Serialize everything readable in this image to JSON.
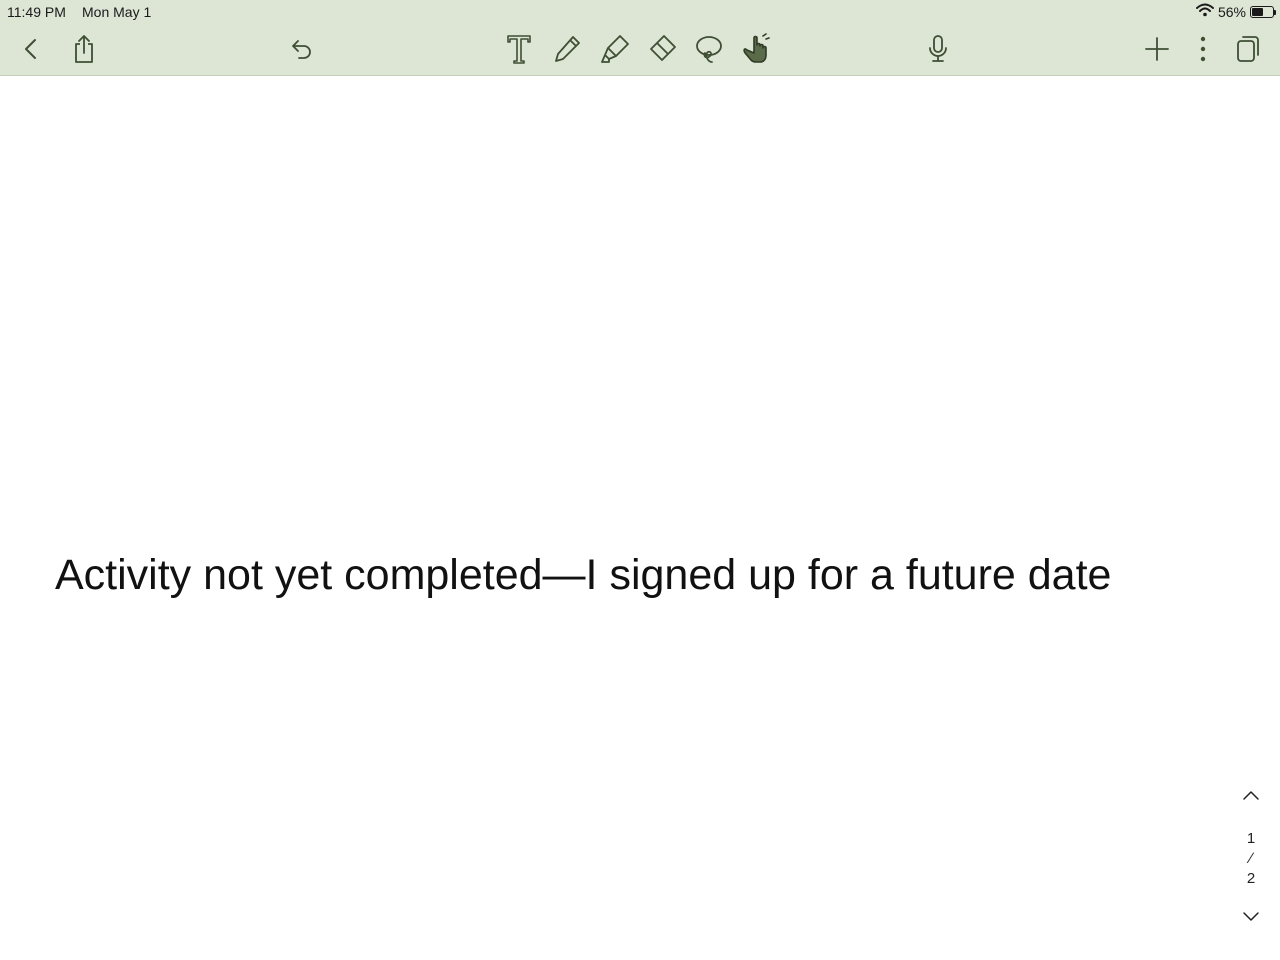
{
  "status_bar": {
    "time": "11:49 PM",
    "date": "Mon May 1",
    "battery_percent": "56%",
    "battery_level": 0.56,
    "icons": [
      "wifi-icon",
      "battery-icon"
    ]
  },
  "toolbar": {
    "left": [
      "back-icon",
      "share-icon",
      "undo-icon"
    ],
    "tools": [
      "text-tool-icon",
      "pen-tool-icon",
      "highlighter-tool-icon",
      "eraser-tool-icon",
      "lasso-tool-icon",
      "hand-tool-icon"
    ],
    "active_tool": "hand-tool-icon",
    "right": [
      "microphone-icon",
      "add-icon",
      "more-icon",
      "pages-icon"
    ],
    "colors": {
      "background": "#dde5d5",
      "icon": "#3f4f34",
      "active_fill": "#5a6b4a"
    }
  },
  "document": {
    "text": "Activity not yet completed—I signed up for a future date"
  },
  "pager": {
    "current": "1",
    "separator": "∕",
    "total": "2"
  }
}
